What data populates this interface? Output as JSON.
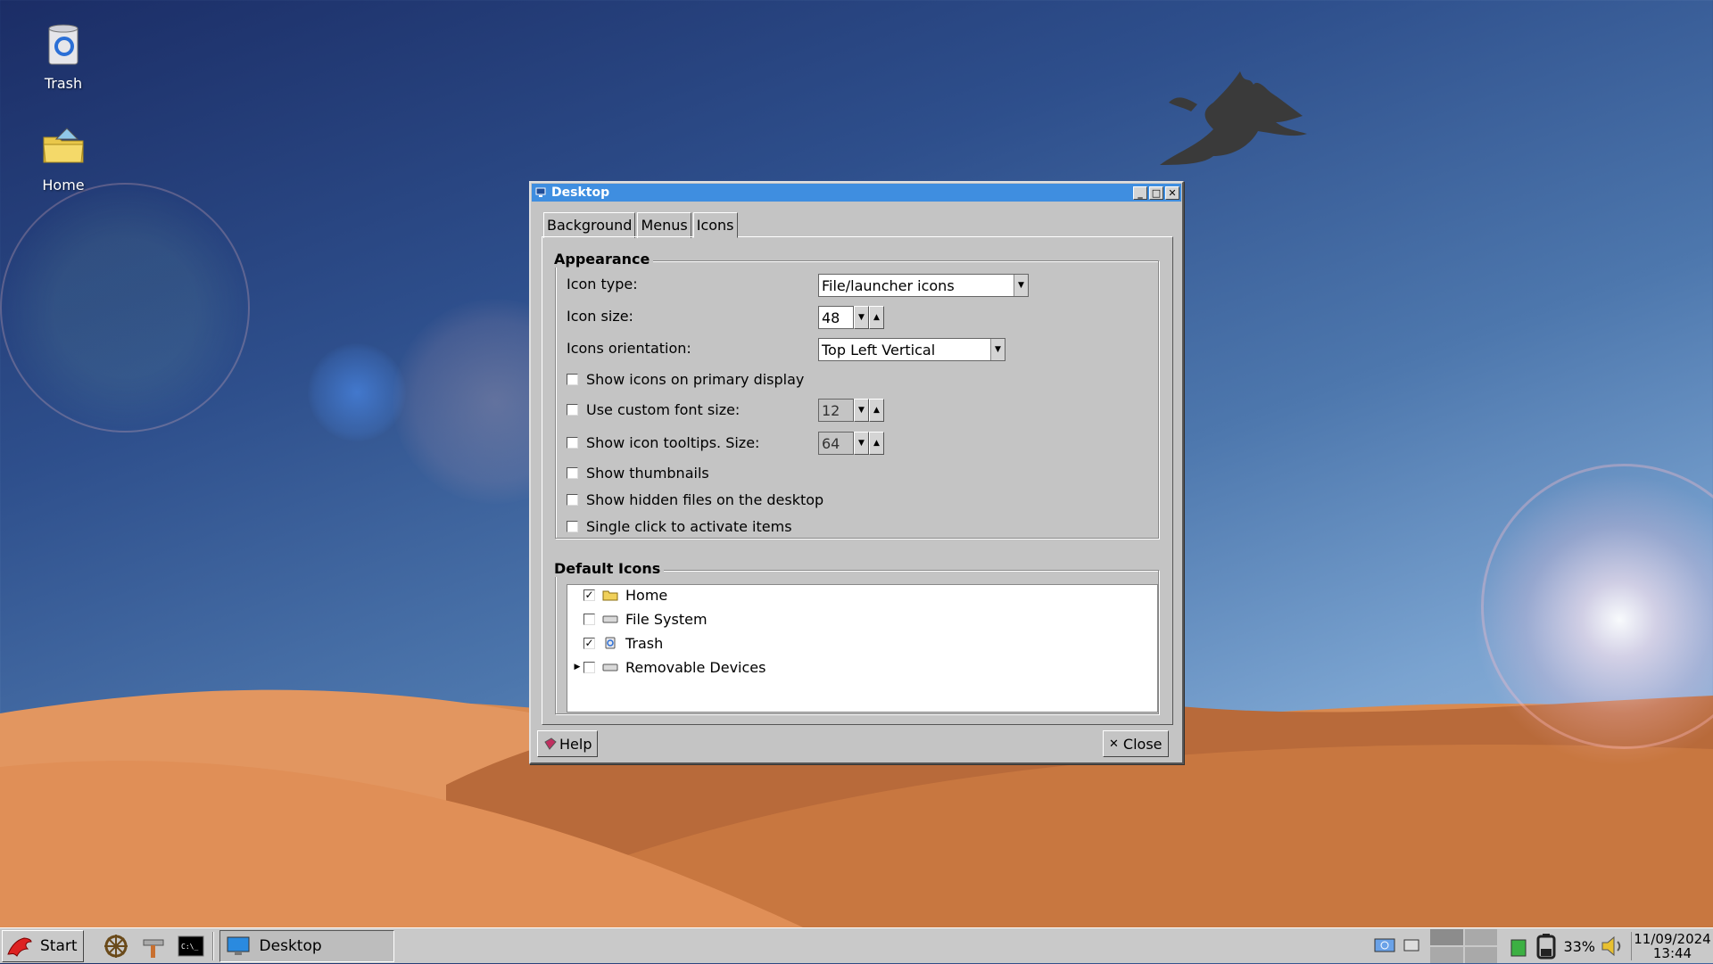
{
  "desktop": {
    "icons": [
      {
        "label": "Trash"
      },
      {
        "label": "Home"
      }
    ]
  },
  "window": {
    "title": "Desktop",
    "tabs": [
      "Background",
      "Menus",
      "Icons"
    ],
    "active_tab": "Icons",
    "appearance": {
      "title": "Appearance",
      "icon_type_label": "Icon type:",
      "icon_type_value": "File/launcher icons",
      "icon_size_label": "Icon size:",
      "icon_size_value": "48",
      "orientation_label": "Icons orientation:",
      "orientation_value": "Top Left Vertical",
      "show_primary": "Show icons on primary display",
      "custom_font_label": "Use custom font size:",
      "custom_font_value": "12",
      "tooltips_label": "Show icon tooltips. Size:",
      "tooltips_value": "64",
      "show_thumbnails": "Show thumbnails",
      "show_hidden": "Show hidden files on the desktop",
      "single_click": "Single click to activate items"
    },
    "default_icons": {
      "title": "Default Icons",
      "items": [
        {
          "label": "Home",
          "checked": true
        },
        {
          "label": "File System",
          "checked": false
        },
        {
          "label": "Trash",
          "checked": true
        },
        {
          "label": "Removable Devices",
          "checked": false
        }
      ]
    },
    "buttons": {
      "help": "Help",
      "close": "Close"
    }
  },
  "taskbar": {
    "start_label": "Start",
    "task_label": "Desktop",
    "battery": "33%",
    "date": "11/09/2024",
    "time": "13:44"
  },
  "colors": {
    "titlebar": "#3f8ee0",
    "dialog_bg": "#c4c4c4",
    "taskbar_bg": "#c9c9c9"
  }
}
